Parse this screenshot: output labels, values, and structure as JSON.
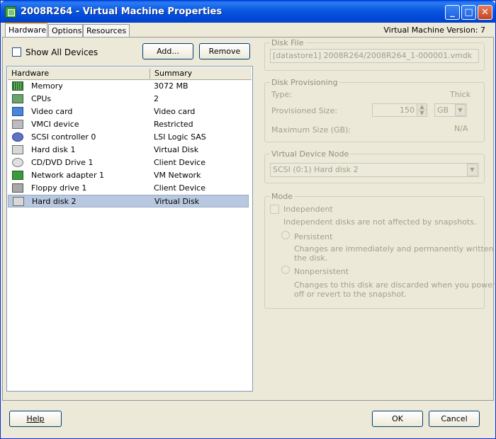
{
  "window": {
    "title": "2008R264 - Virtual Machine Properties",
    "min_glyph": "_",
    "max_glyph": "□",
    "close_glyph": "✕"
  },
  "tabs": {
    "hardware": "Hardware",
    "options": "Options",
    "resources": "Resources"
  },
  "vm_version": "Virtual Machine Version: 7",
  "toolbar": {
    "show_all_devices": "Show All Devices",
    "add": "Add...",
    "remove": "Remove"
  },
  "hardware_list": {
    "col_hardware": "Hardware",
    "col_summary": "Summary",
    "rows": [
      {
        "name": "Memory",
        "summary": "3072 MB",
        "icon": "memory-icon"
      },
      {
        "name": "CPUs",
        "summary": "2",
        "icon": "cpu-icon"
      },
      {
        "name": "Video card",
        "summary": "Video card",
        "icon": "monitor-icon"
      },
      {
        "name": "VMCI device",
        "summary": "Restricted",
        "icon": "vmci-icon"
      },
      {
        "name": "SCSI controller 0",
        "summary": "LSI Logic SAS",
        "icon": "scsi-icon"
      },
      {
        "name": "Hard disk 1",
        "summary": "Virtual Disk",
        "icon": "hard-disk-icon"
      },
      {
        "name": "CD/DVD Drive 1",
        "summary": "Client Device",
        "icon": "cd-icon"
      },
      {
        "name": "Network adapter 1",
        "summary": "VM Network",
        "icon": "network-icon"
      },
      {
        "name": "Floppy drive 1",
        "summary": "Client Device",
        "icon": "floppy-icon"
      },
      {
        "name": "Hard disk 2",
        "summary": "Virtual Disk",
        "icon": "hard-disk-icon"
      }
    ],
    "selected_index": 9
  },
  "disk_file": {
    "title": "Disk File",
    "value": "[datastore1] 2008R264/2008R264_1-000001.vmdk"
  },
  "disk_provisioning": {
    "title": "Disk Provisioning",
    "type_label": "Type:",
    "type_value": "Thick",
    "provisioned_label": "Provisioned Size:",
    "provisioned_value": "150",
    "unit_value": "GB",
    "max_label": "Maximum Size (GB):",
    "max_value": "N/A"
  },
  "virtual_device_node": {
    "title": "Virtual Device Node",
    "value": "SCSI (0:1) Hard disk 2"
  },
  "mode": {
    "title": "Mode",
    "independent_label": "Independent",
    "independent_desc": "Independent disks are not affected by snapshots.",
    "persistent_label": "Persistent",
    "persistent_desc_1": "Changes are immediately and permanently written to",
    "persistent_desc_2": "the disk.",
    "nonpersistent_label": "Nonpersistent",
    "nonpersistent_desc_1": "Changes to this disk are discarded when you power",
    "nonpersistent_desc_2": "off or revert to the snapshot."
  },
  "footer": {
    "help": "Help",
    "ok": "OK",
    "cancel": "Cancel"
  }
}
